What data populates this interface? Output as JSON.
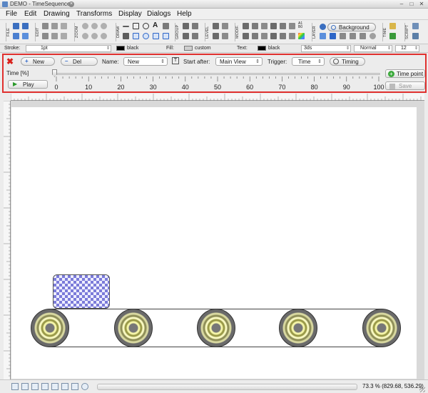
{
  "window": {
    "title": "DEMO - TimeSequence",
    "controls": [
      "–",
      "□",
      "✕"
    ]
  },
  "menu": [
    "File",
    "Edit",
    "Drawing",
    "Transforms",
    "Display",
    "Dialogs",
    "Help"
  ],
  "toolbar": {
    "groups": [
      "FILE",
      "EDIT",
      "ZOOM",
      "DRAW",
      "GROUP",
      "LEVEL",
      "MODIF.",
      "LAYER",
      "TIME",
      "SCRIPT"
    ],
    "background_label": "Background",
    "text_icon": "A",
    "layer_a1": "A1",
    "layer_b0": "B0"
  },
  "properties": {
    "stroke_label": "Stroke:",
    "stroke_value": "1pt",
    "stroke_color": "black",
    "fill_label": "Fill:",
    "fill_value": "custom",
    "text_label": "Text:",
    "text_color": "black",
    "text_font": "3ds",
    "text_style": "Normal",
    "text_size": "12"
  },
  "sequence": {
    "new_label": "New",
    "del_label": "Del",
    "name_label": "Name:",
    "name_value": "New",
    "start_after_label": "Start after:",
    "start_after_value": "Main View",
    "trigger_label": "Trigger:",
    "trigger_value": "Time",
    "timing_label": "Timing",
    "time_label": "Time [%]",
    "time_value": 0,
    "play_label": "Play",
    "time_point_label": "Time point",
    "save_label": "Save",
    "ticks": [
      "0",
      "10",
      "20",
      "30",
      "40",
      "50",
      "60",
      "70",
      "80",
      "90",
      "100"
    ]
  },
  "status": {
    "zoom": "73.3 % (829.68, 536.29)"
  },
  "colors": {
    "highlight_border": "#e0302e",
    "checker": "#7b7bd9"
  }
}
